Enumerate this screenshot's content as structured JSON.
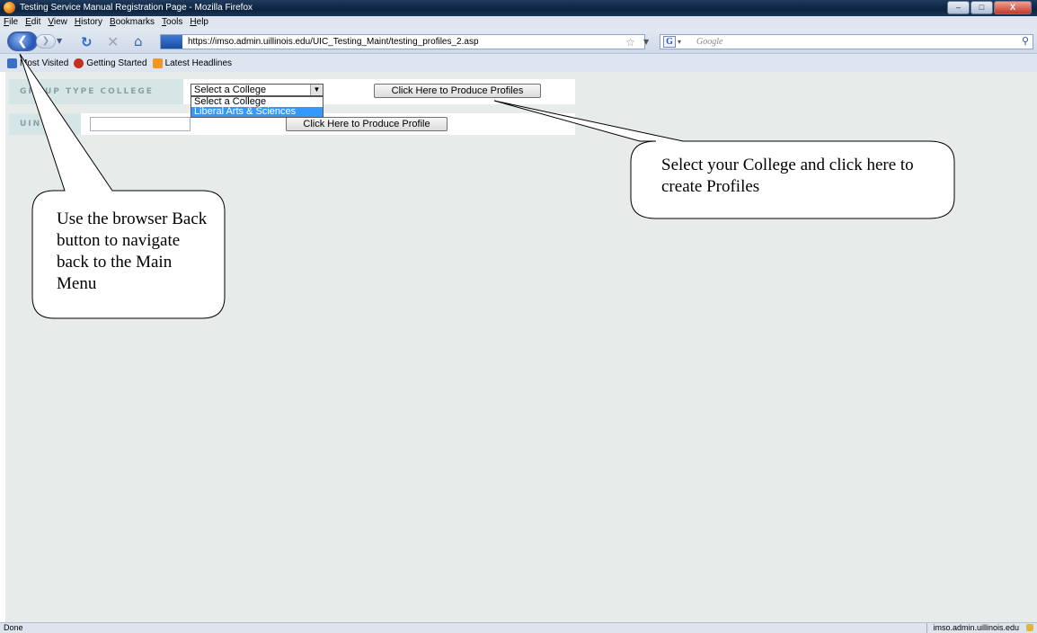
{
  "window": {
    "title": "Testing Service Manual Registration Page - Mozilla Firefox",
    "controls": [
      "–",
      "□",
      "X"
    ]
  },
  "menu": [
    "File",
    "Edit",
    "View",
    "History",
    "Bookmarks",
    "Tools",
    "Help"
  ],
  "nav": {
    "url": "https://imso.admin.uillinois.edu/UIC_Testing_Maint/testing_profiles_2.asp",
    "search_placeholder": "Google"
  },
  "bookmarks": [
    "Most Visited",
    "Getting Started",
    "Latest Headlines"
  ],
  "form": {
    "group_label": "GROUP TYPE COLLEGE",
    "college_select_value": "Select a College",
    "college_options": [
      "Select a College",
      "Liberal Arts & Sciences"
    ],
    "produce_profiles_button": "Click Here to Produce Profiles",
    "uin_label": "UIN",
    "produce_profile_button": "Click Here to Produce Profile"
  },
  "callouts": {
    "left": "Use the browser Back button to navigate back to the Main Menu",
    "right": "Select your College and click here to create Profiles"
  },
  "status": {
    "text": "Done",
    "host": "imso.admin.uillinois.edu"
  }
}
